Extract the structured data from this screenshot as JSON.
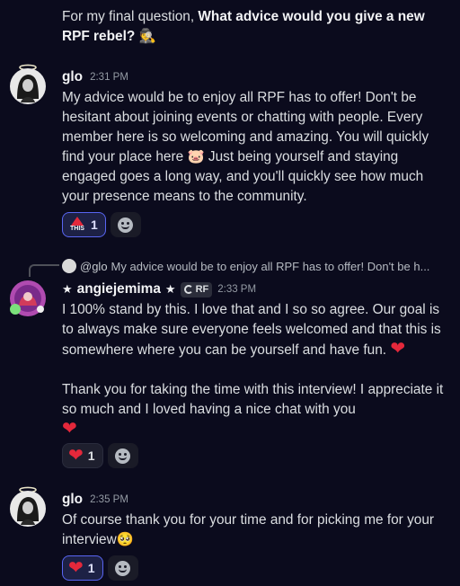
{
  "intro": {
    "prefix": "For my final question, ",
    "bold": "What advice would you give a new RPF rebel?",
    "emoji": "🕵️"
  },
  "messages": [
    {
      "author": "glo",
      "time": "2:31 PM",
      "text_a": "My advice would be to enjoy all RPF has to offer! Don't be hesitant about joining events or chatting with people. Every member here is so welcoming and amazing. You will quickly find your place here ",
      "inline_emoji": "🐷",
      "text_b": " Just being yourself and staying engaged goes a long way, and you'll quickly see how much your presence means to the community.",
      "reactions": [
        {
          "emoji": "THIS",
          "count": "1",
          "active": true
        }
      ]
    },
    {
      "reply_to": {
        "name": "@glo",
        "text": "My advice would be to enjoy all RPF has to offer! Don't be h..."
      },
      "author_star_left": "★",
      "author": "angiejemima",
      "author_star_right": "★",
      "tag": "RF",
      "time": "2:33 PM",
      "text_a": "I 100% stand by this. I love that and I so so agree. Our goal is to always make sure everyone feels welcomed and that this is somewhere where you can be yourself and have fun.",
      "heart": "❤",
      "text_c": "Thank you for taking the time with this interview! I appreciate it so much and I loved having a nice chat with you",
      "reactions": [
        {
          "emoji": "❤",
          "count": "1",
          "active": false
        }
      ]
    },
    {
      "author": "glo",
      "time": "2:35 PM",
      "text_a": "Of course thank you for your time and for picking me for your interview",
      "inline_emoji": "🥺",
      "reactions": [
        {
          "emoji": "❤",
          "count": "1",
          "active": true
        }
      ]
    }
  ],
  "colors": {
    "background": "#0b0b1d",
    "heart": "#e4283b",
    "accent": "#5865f2"
  },
  "icons": {
    "add_reaction": "smiley-add-icon",
    "this_reaction": "this-arrow-icon"
  }
}
